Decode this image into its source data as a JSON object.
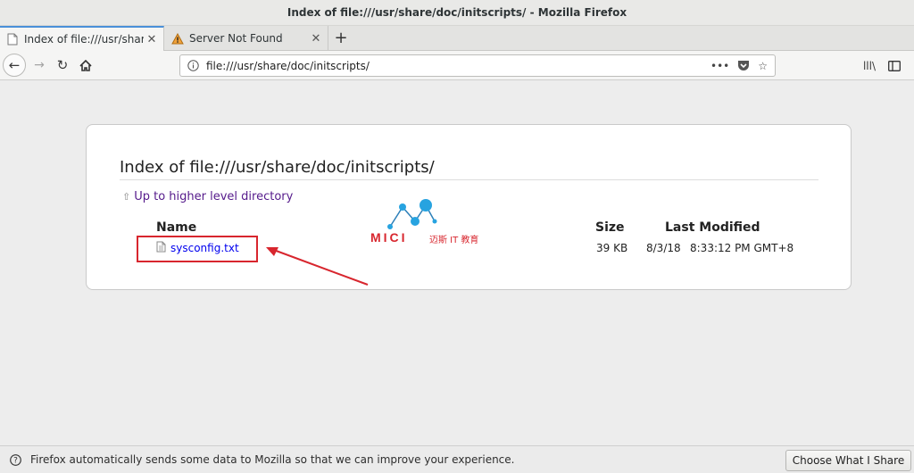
{
  "window": {
    "title": "Index of file:///usr/share/doc/initscripts/ - Mozilla Firefox"
  },
  "tabs": [
    {
      "label": "Index of file:///usr/share/c",
      "icon": "page-icon",
      "active": true
    },
    {
      "label": "Server Not Found",
      "icon": "warning-icon",
      "active": false
    }
  ],
  "newtab": {
    "label": "+"
  },
  "urlbar": {
    "value": "file:///usr/share/doc/initscripts/"
  },
  "page": {
    "heading": "Index of file:///usr/share/doc/initscripts/",
    "up_link": "Up to higher level directory",
    "columns": {
      "name": "Name",
      "size": "Size",
      "modified": "Last Modified"
    },
    "files": [
      {
        "name": "sysconfig.txt",
        "size": "39 KB",
        "date": "8/3/18",
        "time": "8:33:12 PM GMT+8"
      }
    ]
  },
  "watermark": {
    "text": "MICI",
    "subtext": "迈斯 IT 教育"
  },
  "notification": {
    "text": "Firefox automatically sends some data to Mozilla so that we can improve your experience.",
    "button": "Choose What I Share"
  },
  "colors": {
    "annotation": "#d8262e",
    "link": "#0000ee",
    "visited": "#551a8b"
  }
}
